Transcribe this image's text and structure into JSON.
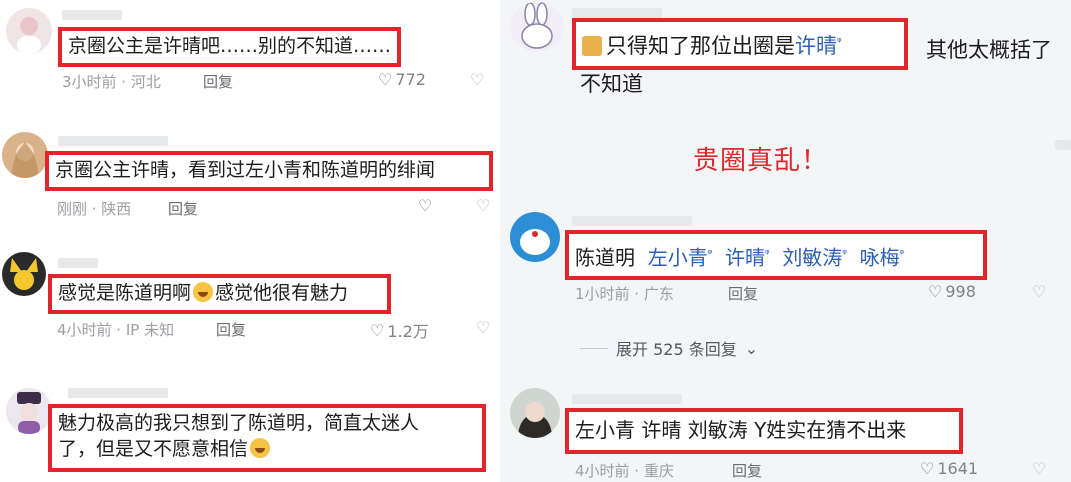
{
  "left_comments": [
    {
      "avatar_icon": "girl-avatar-icon",
      "text": "京圈公主是许晴吧……别的不知道……",
      "meta": "3小时前 · 河北",
      "reply": "回复",
      "likes": "772"
    },
    {
      "avatar_icon": "anime-avatar-icon",
      "text": "京圈公主许晴，看到过左小青和陈道明的绯闻",
      "meta": "刚刚 · 陕西",
      "reply": "回复",
      "likes": ""
    },
    {
      "avatar_icon": "character-avatar-icon",
      "text_before_emoji": "感觉是陈道明啊",
      "text_after_emoji": "感觉他很有魅力",
      "meta": "4小时前 · IP 未知",
      "reply": "回复",
      "likes": "1.2万"
    },
    {
      "avatar_icon": "costume-avatar-icon",
      "text_line1": "魅力极高的我只想到了陈道明，简直太迷人",
      "text_line2": "了，但是又不愿意相信"
    }
  ],
  "right_comments": [
    {
      "avatar_icon": "rabbit-avatar-icon",
      "text_before_tag": "只得知了那位出圈是",
      "tag": "许晴",
      "text_after_box": "其他太概括了",
      "text_line2": "不知道"
    },
    {
      "avatar_icon": "doraemon-avatar-icon",
      "lead": "陈道明",
      "tags": [
        "左小青",
        "许晴",
        "刘敏涛",
        "咏梅"
      ],
      "meta": "1小时前 · 广东",
      "reply": "回复",
      "likes": "998"
    },
    {
      "avatar_icon": "woman-avatar-icon",
      "text": "左小青 许晴 刘敏涛 Y姓实在猜不出来",
      "meta": "4小时前 · 重庆",
      "reply": "回复",
      "likes": "1641"
    }
  ],
  "expand_replies": "展开 525 条回复",
  "caption": "贵圈真乱！",
  "colors": {
    "highlight_border": "#e0262c",
    "tag_blue": "#2b5fb5",
    "caption_red": "#e0262c"
  }
}
